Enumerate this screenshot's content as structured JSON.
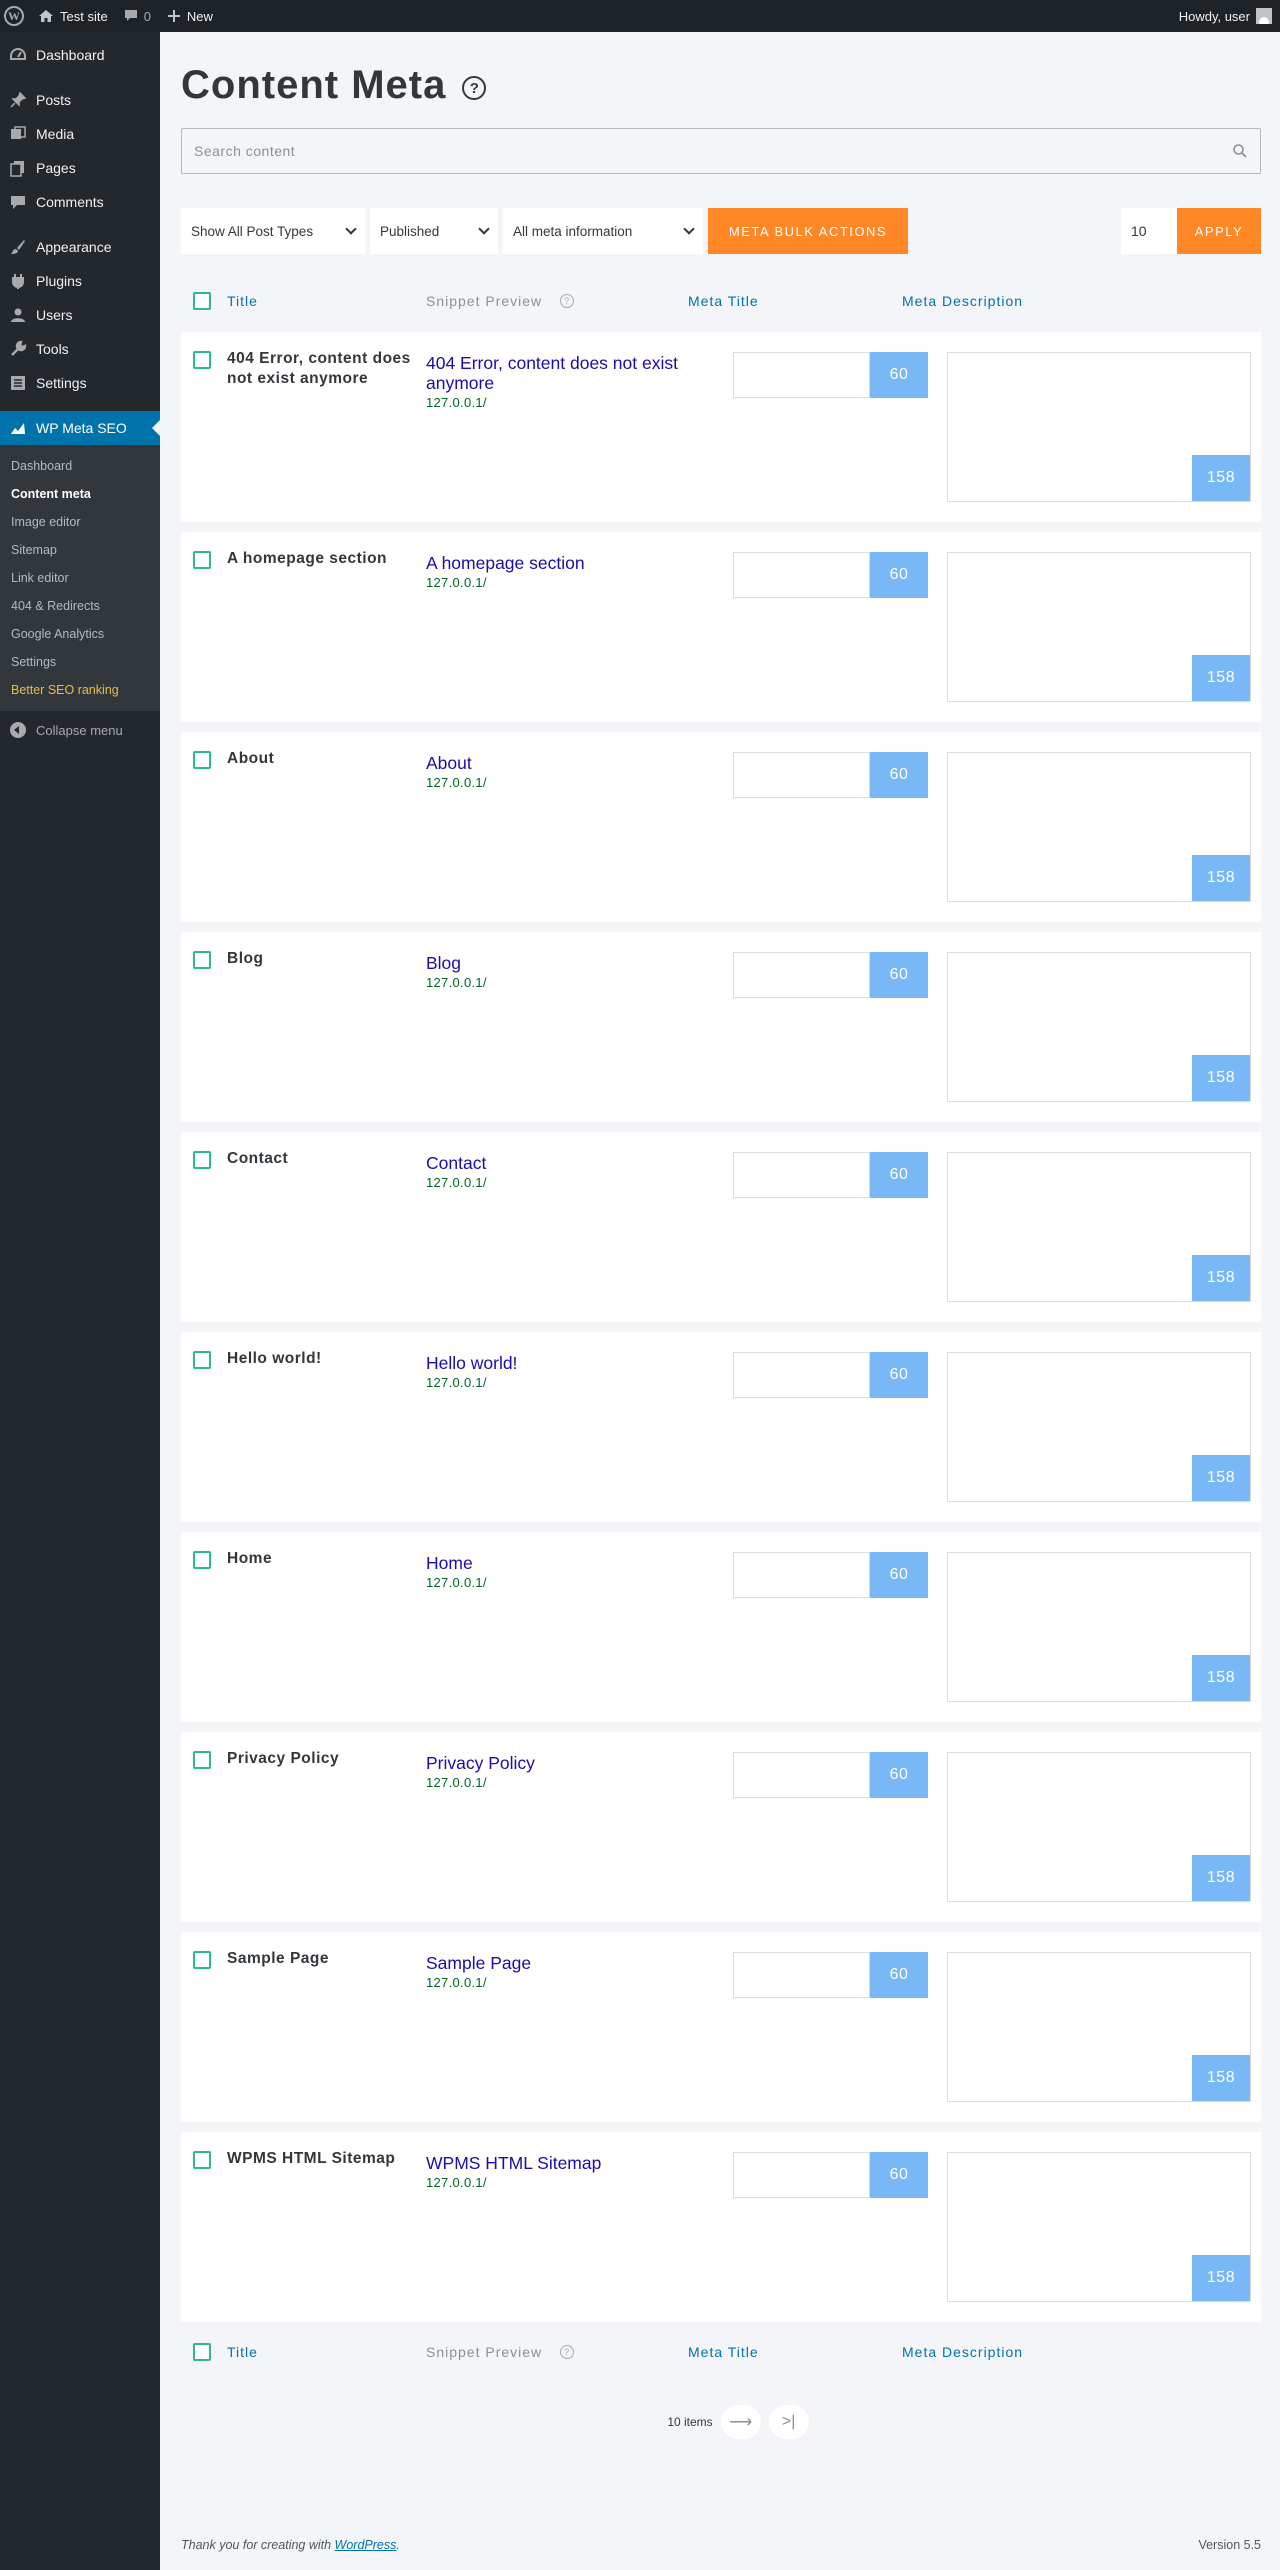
{
  "adminbar": {
    "site_name": "Test site",
    "comments_count": "0",
    "new_label": "New",
    "howdy": "Howdy, user"
  },
  "sidebar": {
    "items": [
      {
        "label": "Dashboard",
        "icon": "dashboard-icon"
      },
      {
        "label": "Posts",
        "icon": "pin-icon"
      },
      {
        "label": "Media",
        "icon": "media-icon"
      },
      {
        "label": "Pages",
        "icon": "pages-icon"
      },
      {
        "label": "Comments",
        "icon": "comment-icon"
      },
      {
        "label": "Appearance",
        "icon": "brush-icon"
      },
      {
        "label": "Plugins",
        "icon": "plugin-icon"
      },
      {
        "label": "Users",
        "icon": "users-icon"
      },
      {
        "label": "Tools",
        "icon": "wrench-icon"
      },
      {
        "label": "Settings",
        "icon": "settings-icon"
      },
      {
        "label": "WP Meta SEO",
        "icon": "chart-icon"
      }
    ],
    "submenu": [
      "Dashboard",
      "Content meta",
      "Image editor",
      "Sitemap",
      "Link editor",
      "404 & Redirects",
      "Google Analytics",
      "Settings",
      "Better SEO ranking"
    ],
    "collapse_label": "Collapse menu"
  },
  "page": {
    "title": "Content Meta",
    "help_glyph": "?",
    "search_placeholder": "Search content"
  },
  "filters": {
    "post_types": "Show All Post Types",
    "status": "Published",
    "meta_info": "All meta information",
    "bulk_actions": "META BULK ACTIONS",
    "per_page": "10",
    "apply": "APPLY"
  },
  "columns": {
    "title": "Title",
    "snippet": "Snippet Preview",
    "meta_title": "Meta Title",
    "meta_description": "Meta Description"
  },
  "rows": [
    {
      "title": "404 Error, content does not exist anymore",
      "snippet_title": "404 Error, content does not exist anymore",
      "url": "127.0.0.1/",
      "meta_title_count": "60",
      "meta_desc_count": "158"
    },
    {
      "title": "A homepage section",
      "snippet_title": "A homepage section",
      "url": "127.0.0.1/",
      "meta_title_count": "60",
      "meta_desc_count": "158"
    },
    {
      "title": "About",
      "snippet_title": "About",
      "url": "127.0.0.1/",
      "meta_title_count": "60",
      "meta_desc_count": "158"
    },
    {
      "title": "Blog",
      "snippet_title": "Blog",
      "url": "127.0.0.1/",
      "meta_title_count": "60",
      "meta_desc_count": "158"
    },
    {
      "title": "Contact",
      "snippet_title": "Contact",
      "url": "127.0.0.1/",
      "meta_title_count": "60",
      "meta_desc_count": "158"
    },
    {
      "title": "Hello world!",
      "snippet_title": "Hello world!",
      "url": "127.0.0.1/",
      "meta_title_count": "60",
      "meta_desc_count": "158"
    },
    {
      "title": "Home",
      "snippet_title": "Home",
      "url": "127.0.0.1/",
      "meta_title_count": "60",
      "meta_desc_count": "158"
    },
    {
      "title": "Privacy Policy",
      "snippet_title": "Privacy Policy",
      "url": "127.0.0.1/",
      "meta_title_count": "60",
      "meta_desc_count": "158"
    },
    {
      "title": "Sample Page",
      "snippet_title": "Sample Page",
      "url": "127.0.0.1/",
      "meta_title_count": "60",
      "meta_desc_count": "158"
    },
    {
      "title": "WPMS HTML Sitemap",
      "snippet_title": "WPMS HTML Sitemap",
      "url": "127.0.0.1/",
      "meta_title_count": "60",
      "meta_desc_count": "158"
    }
  ],
  "pagination": {
    "items_label": "10 items",
    "next_glyph": "⟶",
    "last_glyph": ">|"
  },
  "footer": {
    "thanks_prefix": "Thank you for creating with ",
    "thanks_link": "WordPress",
    "thanks_suffix": ".",
    "version": "Version 5.5"
  },
  "colors": {
    "accent": "#ff8726",
    "badge": "#79b8f7",
    "link": "#0073aa",
    "checkbox": "#2fb597",
    "snippet_title": "#1a0dab",
    "snippet_url": "#006621"
  }
}
